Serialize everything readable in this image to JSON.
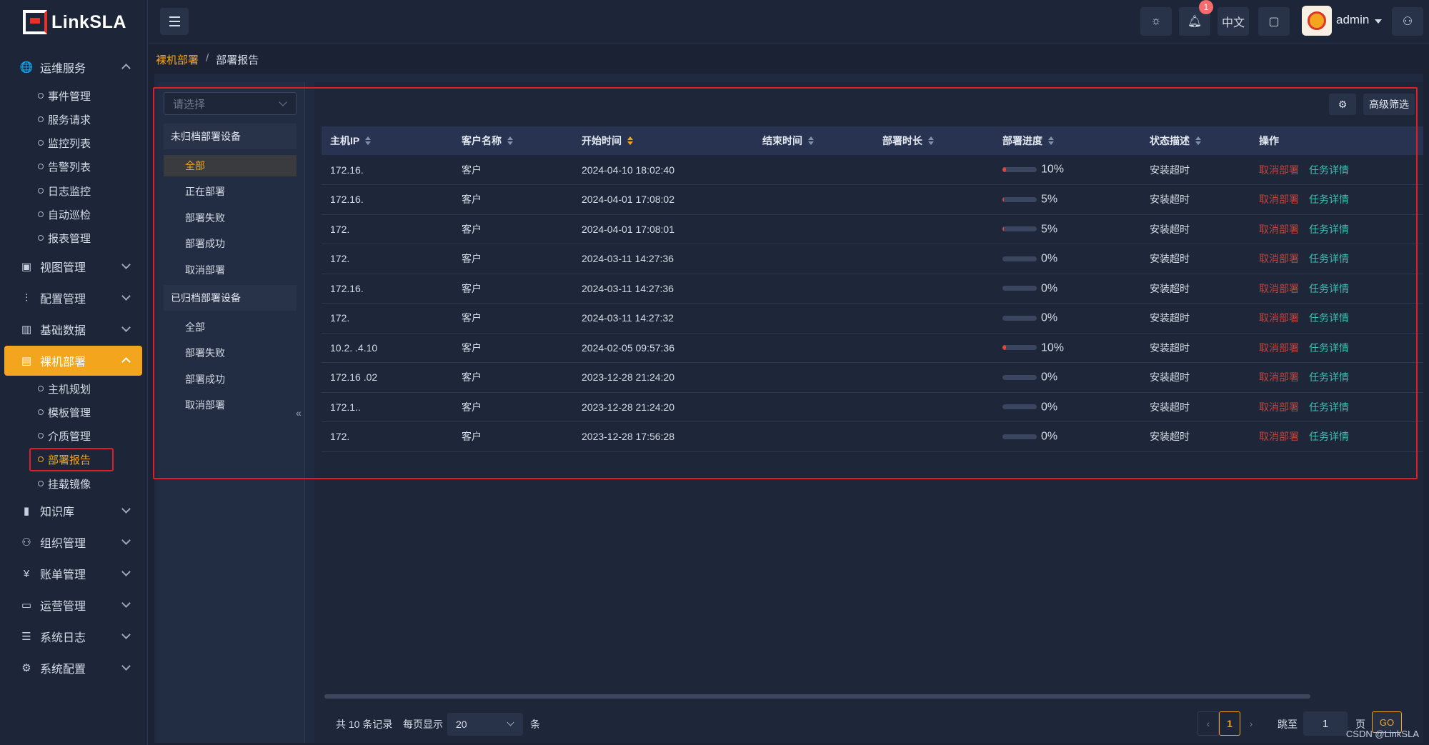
{
  "brand": {
    "name": "LinkSLA"
  },
  "header": {
    "notifications_count": "1",
    "language": "中文",
    "username": "admin",
    "icons": [
      "theme-icon",
      "bell-icon",
      "briefcase-icon",
      "user-settings-icon"
    ]
  },
  "sidebar": {
    "groups": [
      {
        "label": "运维服务",
        "icon": "globe-icon",
        "expanded": true,
        "items": [
          "事件管理",
          "服务请求",
          "监控列表",
          "告警列表",
          "日志监控",
          "自动巡检",
          "报表管理"
        ]
      },
      {
        "label": "视图管理",
        "icon": "chart-icon",
        "expanded": false
      },
      {
        "label": "配置管理",
        "icon": "sliders-icon",
        "expanded": false
      },
      {
        "label": "基础数据",
        "icon": "bar-chart-icon",
        "expanded": false
      },
      {
        "label": "裸机部署",
        "icon": "server-icon",
        "expanded": true,
        "active": true,
        "items": [
          "主机规划",
          "模板管理",
          "介质管理",
          "部署报告",
          "挂载镜像"
        ],
        "active_item": "部署报告"
      },
      {
        "label": "知识库",
        "icon": "books-icon",
        "expanded": false
      },
      {
        "label": "组织管理",
        "icon": "org-user-icon",
        "expanded": false
      },
      {
        "label": "账单管理",
        "icon": "bill-icon",
        "expanded": false
      },
      {
        "label": "运营管理",
        "icon": "operation-icon",
        "expanded": false
      },
      {
        "label": "系统日志",
        "icon": "log-icon",
        "expanded": false
      },
      {
        "label": "系统配置",
        "icon": "gear-icon",
        "expanded": false
      }
    ]
  },
  "breadcrumb": {
    "parent": "裸机部署",
    "separator": "/",
    "current": "部署报告"
  },
  "filter_panel": {
    "select_placeholder": "请选择",
    "unarchived": {
      "title": "未归档部署设备",
      "items": [
        "全部",
        "正在部署",
        "部署失败",
        "部署成功",
        "取消部署"
      ],
      "active_item": "全部"
    },
    "archived": {
      "title": "已归档部署设备",
      "items": [
        "全部",
        "部署失败",
        "部署成功",
        "取消部署"
      ]
    },
    "collapse_glyph": "«"
  },
  "toolbar": {
    "settings_icon": "gear-icon",
    "advanced_filter_label": "高级筛选"
  },
  "table": {
    "columns": [
      "主机IP",
      "客户名称",
      "开始时间",
      "结束时间",
      "部署时长",
      "部署进度",
      "状态描述",
      "操作"
    ],
    "sorted_column": "开始时间",
    "rows": [
      {
        "ip": "172.16.",
        "customer": "客户",
        "start": "2024-04-10 18:02:40",
        "end": "",
        "duration": "",
        "progress": 10,
        "progress_label": "10%",
        "status": "安装超时"
      },
      {
        "ip": "172.16.",
        "customer": "客户",
        "start": "2024-04-01 17:08:02",
        "end": "",
        "duration": "",
        "progress": 5,
        "progress_label": "5%",
        "status": "安装超时"
      },
      {
        "ip": "172.",
        "customer": "客户",
        "start": "2024-04-01 17:08:01",
        "end": "",
        "duration": "",
        "progress": 5,
        "progress_label": "5%",
        "status": "安装超时"
      },
      {
        "ip": "172.",
        "customer": "客户",
        "start": "2024-03-11 14:27:36",
        "end": "",
        "duration": "",
        "progress": 0,
        "progress_label": "0%",
        "status": "安装超时"
      },
      {
        "ip": "172.16.",
        "customer": "客户",
        "start": "2024-03-11 14:27:36",
        "end": "",
        "duration": "",
        "progress": 0,
        "progress_label": "0%",
        "status": "安装超时"
      },
      {
        "ip": "172.",
        "customer": "客户",
        "start": "2024-03-11 14:27:32",
        "end": "",
        "duration": "",
        "progress": 0,
        "progress_label": "0%",
        "status": "安装超时"
      },
      {
        "ip": "10.2.    .4.10",
        "customer": "客户",
        "start": "2024-02-05 09:57:36",
        "end": "",
        "duration": "",
        "progress": 10,
        "progress_label": "10%",
        "status": "安装超时"
      },
      {
        "ip": "172.16   .02",
        "customer": "客户",
        "start": "2023-12-28 21:24:20",
        "end": "",
        "duration": "",
        "progress": 0,
        "progress_label": "0%",
        "status": "安装超时"
      },
      {
        "ip": "172.1..",
        "customer": "客户",
        "start": "2023-12-28 21:24:20",
        "end": "",
        "duration": "",
        "progress": 0,
        "progress_label": "0%",
        "status": "安装超时"
      },
      {
        "ip": "172.",
        "customer": "客户",
        "start": "2023-12-28 17:56:28",
        "end": "",
        "duration": "",
        "progress": 0,
        "progress_label": "0%",
        "status": "安装超时"
      }
    ],
    "actions": {
      "cancel": "取消部署",
      "detail": "任务详情"
    }
  },
  "pagination": {
    "total_label": "共 10 条记录",
    "page_size_label": "每页显示",
    "page_size": "20",
    "unit": "条",
    "current_page": "1",
    "jump_label": "跳至",
    "jump_value": "1",
    "page_unit": "页",
    "go_label": "GO"
  },
  "watermark": "CSDN @LinkSLA",
  "colors": {
    "accent": "#f3a51d",
    "danger": "#c0453d",
    "link": "#3fc0b4",
    "progress": "#e0443a",
    "highlight_box": "#e21d2a"
  }
}
